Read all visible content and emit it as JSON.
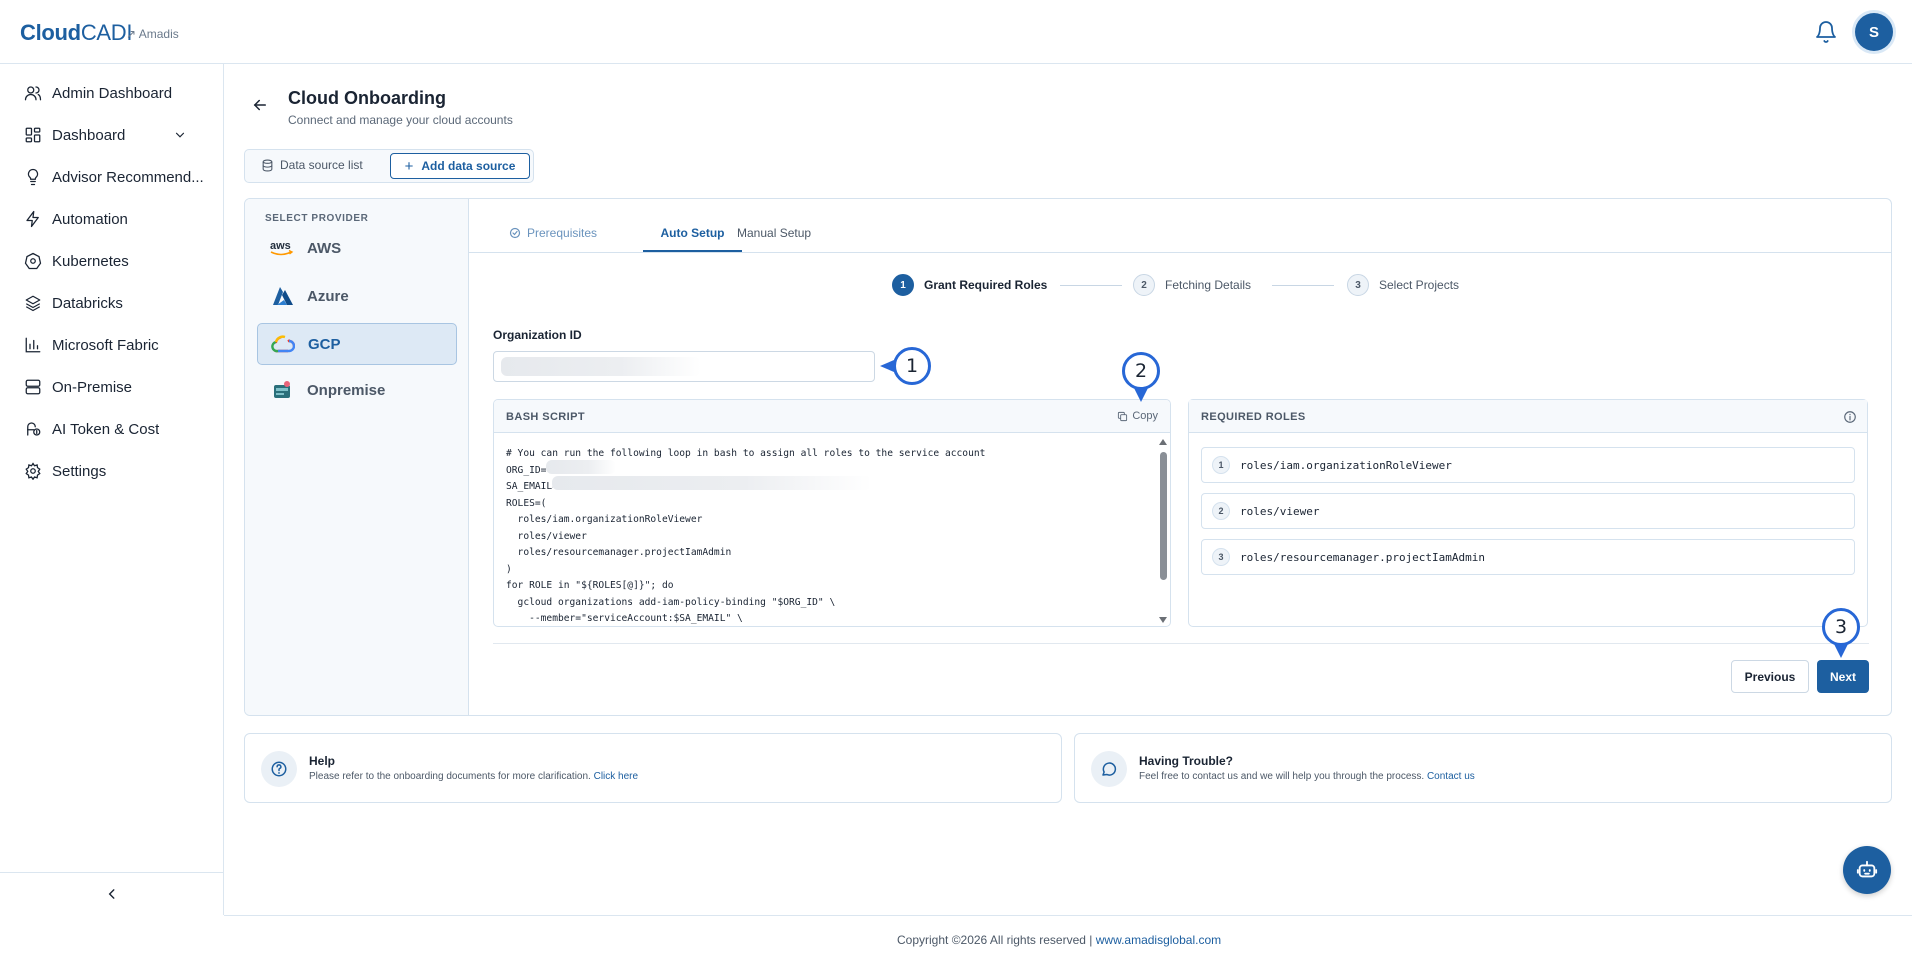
{
  "header": {
    "logo_bold": "Cloud",
    "logo_thin": "CADI",
    "org_name": "↗ Amadis",
    "avatar_initial": "S"
  },
  "sidebar": {
    "items": [
      {
        "label": "Admin Dashboard",
        "icon": "users-icon"
      },
      {
        "label": "Dashboard",
        "icon": "dashboard-icon"
      },
      {
        "label": "Advisor Recommend...",
        "icon": "lightbulb-icon"
      },
      {
        "label": "Automation",
        "icon": "bolt-icon"
      },
      {
        "label": "Kubernetes",
        "icon": "kubernetes-icon"
      },
      {
        "label": "Databricks",
        "icon": "layers-icon"
      },
      {
        "label": "Microsoft Fabric",
        "icon": "bar-chart-icon"
      },
      {
        "label": "On-Premise",
        "icon": "server-icon"
      },
      {
        "label": "AI Token & Cost",
        "icon": "ai-token-icon"
      },
      {
        "label": "Settings",
        "icon": "gear-icon"
      }
    ],
    "collapse_icon": "chevron-left-icon"
  },
  "page": {
    "title": "Cloud Onboarding",
    "subtitle": "Connect and manage your cloud accounts"
  },
  "datasource_tabs": {
    "list_label": "Data source list",
    "add_label": "Add data source"
  },
  "providers": {
    "heading": "SELECT PROVIDER",
    "items": [
      {
        "label": "AWS"
      },
      {
        "label": "Azure"
      },
      {
        "label": "GCP"
      },
      {
        "label": "Onpremise"
      }
    ],
    "aws_logo_text": "aws",
    "selected": "GCP"
  },
  "setup_tabs": {
    "items": [
      {
        "label": "Prerequisites"
      },
      {
        "label": "Auto Setup"
      },
      {
        "label": "Manual Setup"
      }
    ],
    "active": "Auto Setup"
  },
  "stepper": {
    "steps": [
      {
        "num": "1",
        "label": "Grant Required Roles"
      },
      {
        "num": "2",
        "label": "Fetching Details"
      },
      {
        "num": "3",
        "label": "Select Projects"
      }
    ],
    "active_step": 1
  },
  "form": {
    "org_id_label": "Organization ID",
    "org_id_value": ""
  },
  "callouts": {
    "c1": "1",
    "c2": "2",
    "c3": "3"
  },
  "bash_script": {
    "title": "BASH SCRIPT",
    "copy_label": "Copy",
    "lines": [
      "# You can run the following loop in bash to assign all roles to the service account",
      "ORG_ID=",
      "SA_EMAIL=",
      "ROLES=(",
      "  roles/iam.organizationRoleViewer",
      "  roles/viewer",
      "  roles/resourcemanager.projectIamAdmin",
      ")",
      "for ROLE in \"${ROLES[@]}\"; do",
      "  gcloud organizations add-iam-policy-binding \"$ORG_ID\" \\",
      "    --member=\"serviceAccount:$SA_EMAIL\" \\"
    ]
  },
  "required_roles": {
    "title": "REQUIRED ROLES",
    "items": [
      {
        "num": "1",
        "role": "roles/iam.organizationRoleViewer"
      },
      {
        "num": "2",
        "role": "roles/viewer"
      },
      {
        "num": "3",
        "role": "roles/resourcemanager.projectIamAdmin"
      }
    ]
  },
  "actions": {
    "previous_label": "Previous",
    "next_label": "Next"
  },
  "help": {
    "title": "Help",
    "text": "Please refer to the onboarding documents for more clarification.",
    "link": "Click here"
  },
  "trouble": {
    "title": "Having Trouble?",
    "text": "Feel free to contact us and we will help you through the process.",
    "link": "Contact us"
  },
  "footer": {
    "copyright": "Copyright ©2026 All rights reserved |",
    "link": "www.amadisglobal.com"
  },
  "colors": {
    "brand": "#1d5fa0",
    "callout_ring": "#2767d6",
    "border": "#d5e2ee"
  }
}
